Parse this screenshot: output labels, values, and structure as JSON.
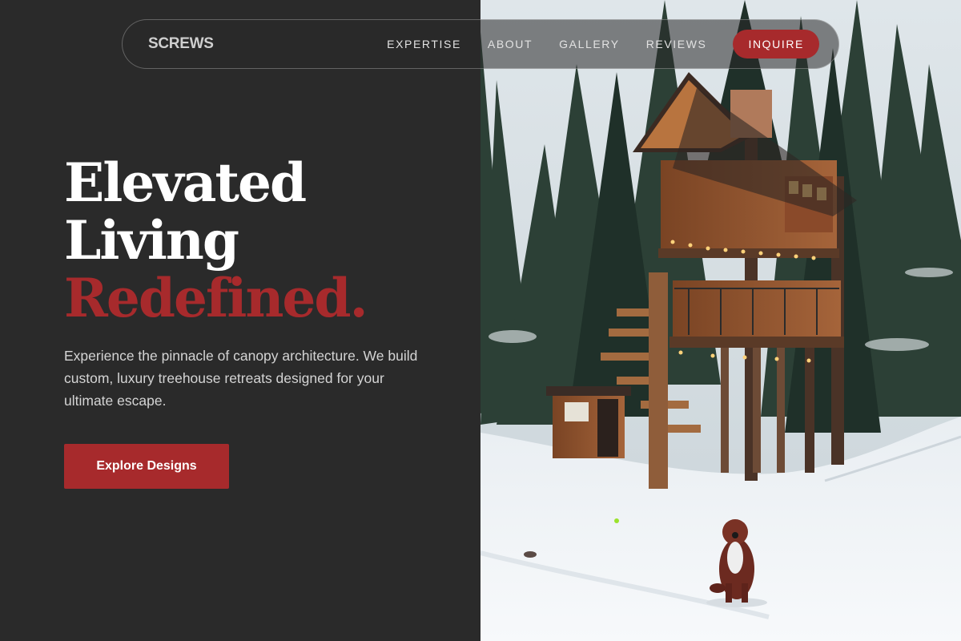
{
  "brand": {
    "logo": "SCREWS"
  },
  "nav": {
    "links": [
      "EXPERTISE",
      "ABOUT",
      "GALLERY",
      "REVIEWS"
    ],
    "cta": "INQUIRE"
  },
  "hero": {
    "headline_line1": "Elevated",
    "headline_line2": "Living",
    "headline_line3": "Redefined.",
    "subtext": "Experience the pinnacle of canopy architecture. We build custom, luxury treehouse retreats designed for your ultimate escape.",
    "cta": "Explore Designs",
    "image_subject": "treehouse in snowy forest with dog"
  },
  "colors": {
    "background": "#2a2a2a",
    "accent": "#a72a2c",
    "text_primary": "#ffffff",
    "text_secondary": "#d4d4d4"
  }
}
